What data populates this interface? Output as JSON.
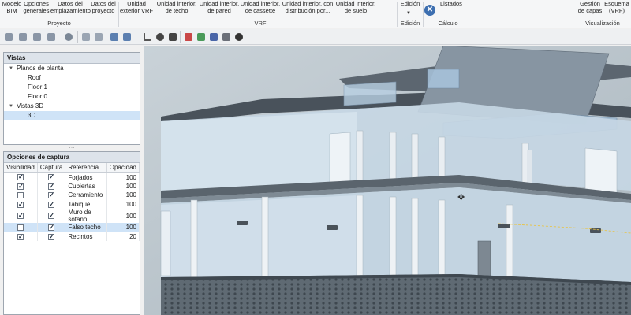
{
  "ribbon": {
    "buttons": [
      {
        "id": "modelo-bim",
        "line1": "Modelo",
        "line2": "BIM"
      },
      {
        "id": "opciones-generales",
        "line1": "Opciones",
        "line2": "generales"
      },
      {
        "id": "datos-emplazamiento",
        "line1": "Datos del",
        "line2": "emplazamiento"
      },
      {
        "id": "datos-proyecto",
        "line1": "Datos del",
        "line2": "proyecto"
      },
      {
        "id": "unidad-exterior-vrf",
        "line1": "Unidad",
        "line2": "exterior VRF"
      },
      {
        "id": "unidad-interior-techo",
        "line1": "Unidad interior,",
        "line2": "de techo"
      },
      {
        "id": "unidad-interior-pared",
        "line1": "Unidad interior,",
        "line2": "de pared"
      },
      {
        "id": "unidad-interior-cassette",
        "line1": "Unidad interior,",
        "line2": "de cassette"
      },
      {
        "id": "unidad-interior-distribucion",
        "line1": "Unidad interior, con",
        "line2": "distribución por..."
      },
      {
        "id": "unidad-interior-suelo",
        "line1": "Unidad interior,",
        "line2": "de suelo"
      },
      {
        "id": "edicion",
        "line1": "Edición",
        "line2": ""
      },
      {
        "id": "listados",
        "line1": "Listados",
        "line2": ""
      },
      {
        "id": "gestion-capas",
        "line1": "Gestión",
        "line2": "de capas"
      },
      {
        "id": "esquema-vrf",
        "line1": "Esquema",
        "line2": "(VRF)"
      }
    ],
    "groups": {
      "proyecto": "Proyecto",
      "vrf": "VRF",
      "edicion": "Edición",
      "calculo": "Cálculo",
      "visualizacion": "Visualización"
    }
  },
  "vistas": {
    "title": "Vistas",
    "planos_label": "Planos de planta",
    "planos": [
      "Roof",
      "Floor 1",
      "Floor 0"
    ],
    "vistas3d_label": "Vistas 3D",
    "vistas3d": [
      "3D"
    ]
  },
  "captura": {
    "title": "Opciones de captura",
    "headers": [
      "Visibilidad",
      "Captura",
      "Referencia",
      "Opacidad"
    ],
    "rows": [
      {
        "visible": true,
        "captura": true,
        "referencia": "Forjados",
        "opacidad": "100"
      },
      {
        "visible": true,
        "captura": true,
        "referencia": "Cubiertas",
        "opacidad": "100"
      },
      {
        "visible": false,
        "captura": true,
        "referencia": "Cerramiento",
        "opacidad": "100"
      },
      {
        "visible": true,
        "captura": true,
        "referencia": "Tabique",
        "opacidad": "100"
      },
      {
        "visible": true,
        "captura": true,
        "referencia": "Muro de sótano",
        "opacidad": "100"
      },
      {
        "visible": false,
        "captura": true,
        "referencia": "Falso techo",
        "opacidad": "100"
      },
      {
        "visible": true,
        "captura": true,
        "referencia": "Recintos",
        "opacidad": "20"
      }
    ]
  },
  "colors": {
    "accent": "#3d6fb0",
    "selection": "#cfe3f7",
    "panel_header": "#dde3ea",
    "viewport_bg": "#b9c4cb"
  }
}
